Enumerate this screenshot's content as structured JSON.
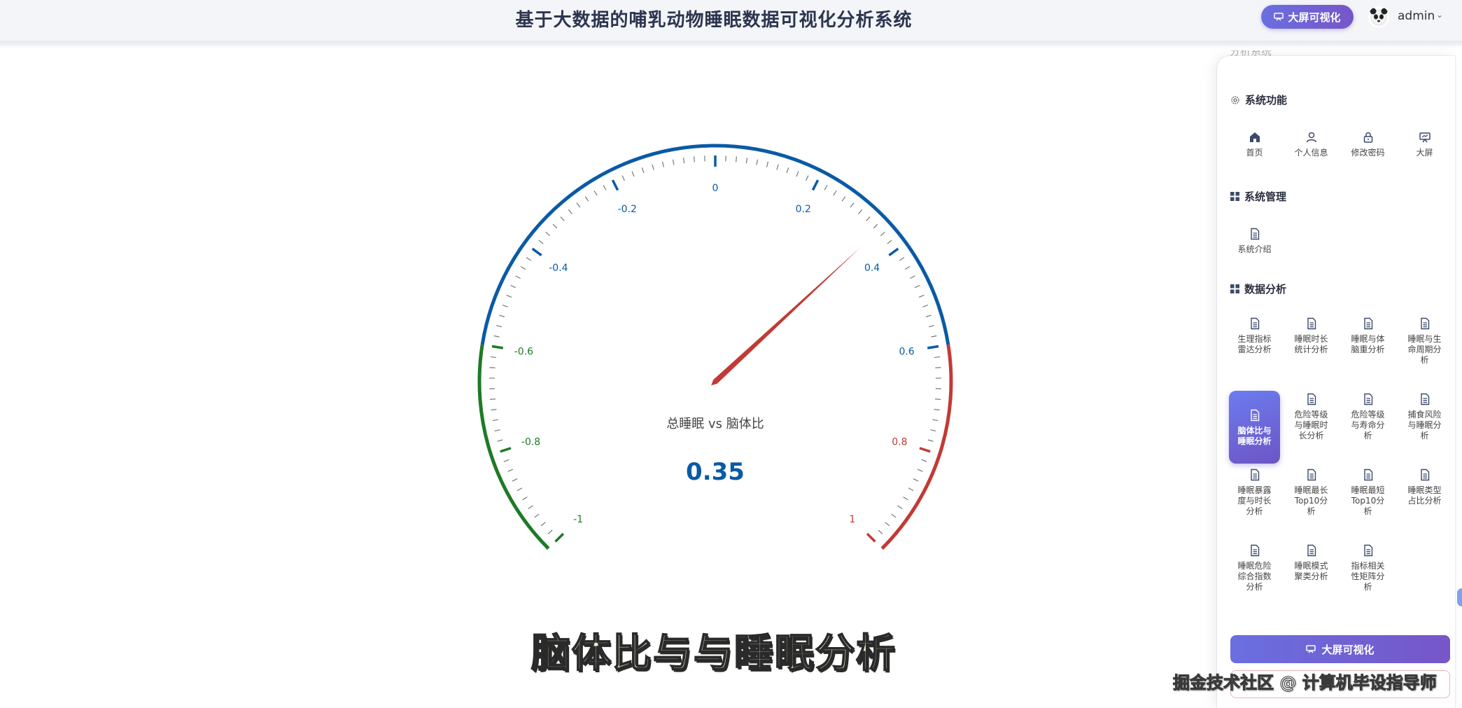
{
  "header": {
    "title": "基于大数据的哺乳动物睡眠数据可视化分析系统",
    "big_screen_button": "大屏可视化",
    "username": "admin"
  },
  "gauge": {
    "label": "总睡眠 vs 脑体比",
    "value_text": "0.35",
    "value": 0.35,
    "min": -1,
    "max": 1,
    "tick_labels": [
      "-1",
      "-0.8",
      "-0.6",
      "-0.4",
      "-0.2",
      "0",
      "0.2",
      "0.4",
      "0.6",
      "0.8",
      "1"
    ],
    "bands": [
      {
        "from": -1,
        "to": -0.6,
        "color": "#1e7a26"
      },
      {
        "from": -0.6,
        "to": 0.6,
        "color": "#0a5aa6"
      },
      {
        "from": 0.6,
        "to": 1,
        "color": "#c23a35"
      }
    ],
    "pointer_color": "#c23a35",
    "value_color": "#0a5aa6"
  },
  "subtitle_overlay": "脑体比与与睡眠分析",
  "watermark": "掘金技术社区 @ 计算机毕设指导师",
  "panel": {
    "cutoff_text": "分析系统",
    "sections": {
      "functions": {
        "title": "系统功能",
        "items": [
          {
            "label": "首页",
            "icon": "home-icon"
          },
          {
            "label": "个人信息",
            "icon": "user-icon"
          },
          {
            "label": "修改密码",
            "icon": "lock-icon"
          },
          {
            "label": "大屏",
            "icon": "screen-icon"
          }
        ]
      },
      "management": {
        "title": "系统管理",
        "items": [
          {
            "label": "系统介绍",
            "icon": "document-icon"
          }
        ]
      },
      "analysis": {
        "title": "数据分析",
        "items": [
          {
            "label": "生理指标\n雷达分析",
            "icon": "document-icon"
          },
          {
            "label": "睡眠时长\n统计分析",
            "icon": "document-icon"
          },
          {
            "label": "睡眠与体\n脑重分析",
            "icon": "document-icon"
          },
          {
            "label": "睡眠与生\n命周期分\n析",
            "icon": "document-icon"
          },
          {
            "label": "脑体比与\n睡眠分析",
            "icon": "document-icon",
            "active": true
          },
          {
            "label": "危险等级\n与睡眠时\n长分析",
            "icon": "document-icon"
          },
          {
            "label": "危险等级\n与寿命分\n析",
            "icon": "document-icon"
          },
          {
            "label": "捕食风险\n与睡眠分\n析",
            "icon": "document-icon"
          },
          {
            "label": "睡眠暴露\n度与时长\n分析",
            "icon": "document-icon"
          },
          {
            "label": "睡眠最长\nTop10分\n析",
            "icon": "document-icon"
          },
          {
            "label": "睡眠最短\nTop10分\n析",
            "icon": "document-icon"
          },
          {
            "label": "睡眠类型\n占比分析",
            "icon": "document-icon"
          },
          {
            "label": "睡眠危险\n综合指数\n分析",
            "icon": "document-icon"
          },
          {
            "label": "睡眠模式\n聚类分析",
            "icon": "document-icon"
          },
          {
            "label": "指标相关\n性矩阵分\n析",
            "icon": "document-icon"
          }
        ]
      }
    },
    "bottom_button": "大屏可视化"
  }
}
